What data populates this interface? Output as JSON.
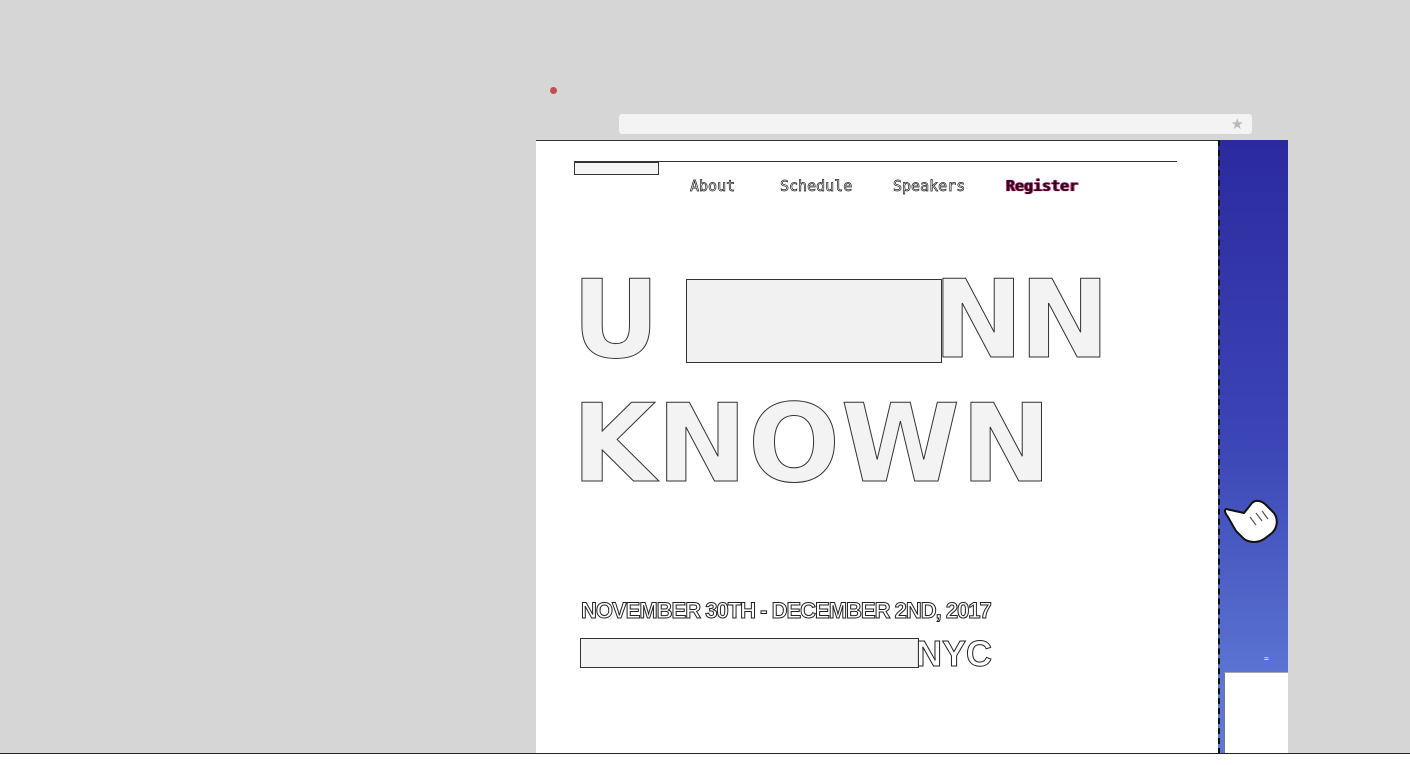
{
  "browser": {
    "bookmark_icon": "star-icon",
    "bookmark_glyph": "★"
  },
  "nav": {
    "items": [
      {
        "label": "About"
      },
      {
        "label": "Schedule"
      },
      {
        "label": "Speakers"
      },
      {
        "label": "Register"
      }
    ]
  },
  "hero": {
    "line1_start": "U",
    "line1_end": "NN",
    "line2": "KNOWN"
  },
  "event": {
    "dates": "NOVEMBER 30TH - DECEMBER 2ND, 2017",
    "city": "NYC"
  },
  "side_panel": {
    "mark": "=",
    "cursor_icon": "hand-pointer-icon"
  },
  "colors": {
    "background": "#d6d6d6",
    "page": "#ffffff",
    "register_accent": "#c2397a",
    "side_panel_top": "#2b2a9e",
    "side_panel_bottom": "#5d78d4"
  }
}
